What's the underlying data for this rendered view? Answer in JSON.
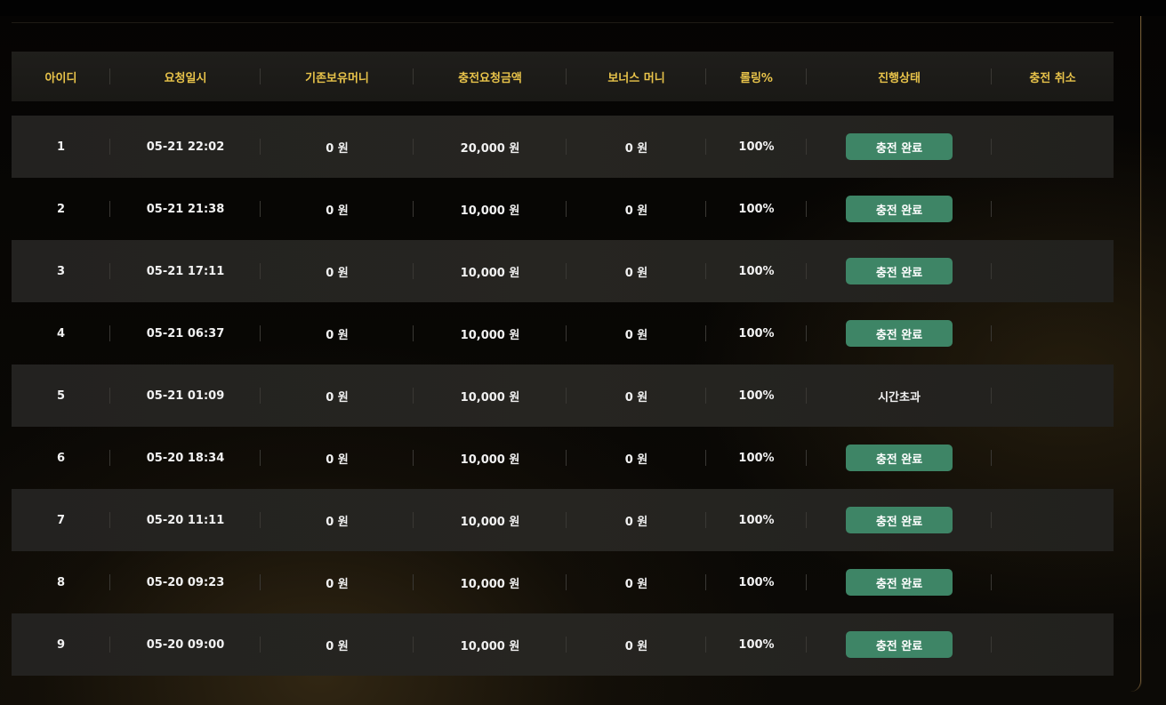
{
  "table": {
    "headers": [
      "아이디",
      "요청일시",
      "기존보유머니",
      "충전요청금액",
      "보너스 머니",
      "롤링%",
      "진행상태",
      "충전 취소"
    ],
    "rows": [
      {
        "id": "1",
        "datetime": "05-21 22:02",
        "prev_money": "0 원",
        "amount": "20,000 원",
        "bonus": "0 원",
        "rolling": "100%",
        "status": "충전 완료",
        "status_type": "button"
      },
      {
        "id": "2",
        "datetime": "05-21 21:38",
        "prev_money": "0 원",
        "amount": "10,000 원",
        "bonus": "0 원",
        "rolling": "100%",
        "status": "충전 완료",
        "status_type": "button"
      },
      {
        "id": "3",
        "datetime": "05-21 17:11",
        "prev_money": "0 원",
        "amount": "10,000 원",
        "bonus": "0 원",
        "rolling": "100%",
        "status": "충전 완료",
        "status_type": "button"
      },
      {
        "id": "4",
        "datetime": "05-21 06:37",
        "prev_money": "0 원",
        "amount": "10,000 원",
        "bonus": "0 원",
        "rolling": "100%",
        "status": "충전 완료",
        "status_type": "button"
      },
      {
        "id": "5",
        "datetime": "05-21 01:09",
        "prev_money": "0 원",
        "amount": "10,000 원",
        "bonus": "0 원",
        "rolling": "100%",
        "status": "시간초과",
        "status_type": "text"
      },
      {
        "id": "6",
        "datetime": "05-20 18:34",
        "prev_money": "0 원",
        "amount": "10,000 원",
        "bonus": "0 원",
        "rolling": "100%",
        "status": "충전 완료",
        "status_type": "button"
      },
      {
        "id": "7",
        "datetime": "05-20 11:11",
        "prev_money": "0 원",
        "amount": "10,000 원",
        "bonus": "0 원",
        "rolling": "100%",
        "status": "충전 완료",
        "status_type": "button"
      },
      {
        "id": "8",
        "datetime": "05-20 09:23",
        "prev_money": "0 원",
        "amount": "10,000 원",
        "bonus": "0 원",
        "rolling": "100%",
        "status": "충전 완료",
        "status_type": "button"
      },
      {
        "id": "9",
        "datetime": "05-20 09:00",
        "prev_money": "0 원",
        "amount": "10,000 원",
        "bonus": "0 원",
        "rolling": "100%",
        "status": "충전 완료",
        "status_type": "button"
      }
    ]
  },
  "colors": {
    "header_text": "#e8c34a",
    "status_button": "#3e8566",
    "row_shade": "#252420"
  }
}
